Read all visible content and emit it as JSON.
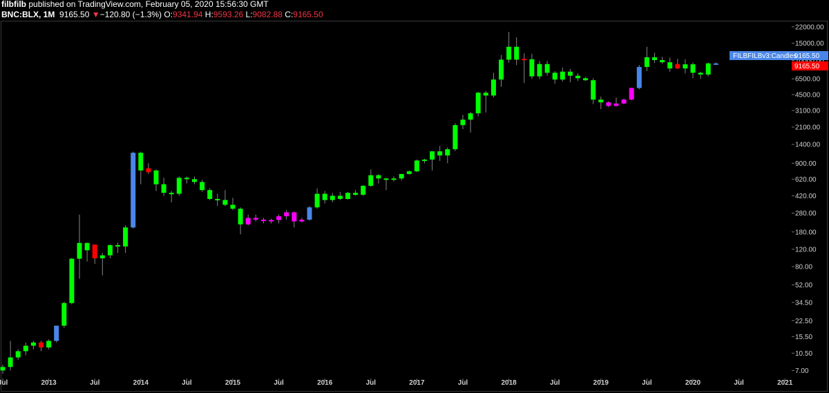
{
  "header": {
    "author": "filbfilb",
    "published_text": "published on TradingView.com, February 05, 2020 15:56:30 GMT",
    "symbol": "BNC:BLX, 1M",
    "last": "9165.50",
    "change_arrow": "▼",
    "change": "−120.80 (−1.3%)",
    "o_label": "O:",
    "o": "9341.94",
    "h_label": "H:",
    "h": "9593.26",
    "l_label": "L:",
    "l": "9082.88",
    "c_label": "C:",
    "c": "9165.50"
  },
  "colors": {
    "up": "#00ff00",
    "down": "#ff0000",
    "blue": "#4a86e8",
    "magenta": "#ff00ff",
    "wick": "#888888",
    "price_label_red": "#ff0000",
    "indicator_label_blue": "#4a86e8"
  },
  "chart_data": {
    "type": "candlestick",
    "scale": "log",
    "ylim": [
      5.8,
      25000
    ],
    "y_ticks": [
      "22000.00",
      "15000.00",
      "10000.00",
      "6500.00",
      "4500.00",
      "3100.00",
      "2100.00",
      "1400.00",
      "900.00",
      "620.00",
      "420.00",
      "280.00",
      "180.00",
      "120.00",
      "80.00",
      "52.00",
      "34.50",
      "22.50",
      "15.50",
      "10.50",
      "7.00"
    ],
    "x_ticks": [
      "Jul",
      "2013",
      "Jul",
      "2014",
      "Jul",
      "2015",
      "Jul",
      "2016",
      "Jul",
      "2017",
      "Jul",
      "2018",
      "Jul",
      "2019",
      "Jul",
      "2020",
      "Jul",
      "2021"
    ],
    "start_month": "2012-07",
    "price_labels": [
      {
        "text": "FILBFILBv3:Candles",
        "value": "9165.50",
        "color": "blue"
      },
      {
        "text": "",
        "value": "9165.50",
        "color": "red"
      }
    ],
    "candles": [
      {
        "o": 7.0,
        "h": 8.0,
        "l": 6.5,
        "c": 7.6,
        "k": "g"
      },
      {
        "o": 7.6,
        "h": 14.0,
        "l": 7.0,
        "c": 9.5,
        "k": "g"
      },
      {
        "o": 9.5,
        "h": 11.5,
        "l": 9.0,
        "c": 11.0,
        "k": "g"
      },
      {
        "o": 11.0,
        "h": 13.5,
        "l": 10.0,
        "c": 12.5,
        "k": "g"
      },
      {
        "o": 12.5,
        "h": 14.0,
        "l": 11.5,
        "c": 13.5,
        "k": "g"
      },
      {
        "o": 13.5,
        "h": 14.0,
        "l": 11.0,
        "c": 12.0,
        "k": "r"
      },
      {
        "o": 12.0,
        "h": 14.5,
        "l": 11.5,
        "c": 14.0,
        "k": "g"
      },
      {
        "o": 14.0,
        "h": 20.0,
        "l": 13.5,
        "c": 20.0,
        "k": "b"
      },
      {
        "o": 20.0,
        "h": 35.0,
        "l": 19.0,
        "c": 34.0,
        "k": "g"
      },
      {
        "o": 34.0,
        "h": 98.0,
        "l": 33.0,
        "c": 96.0,
        "k": "g"
      },
      {
        "o": 96.0,
        "h": 270.0,
        "l": 60.0,
        "c": 139.0,
        "k": "g"
      },
      {
        "o": 139.0,
        "h": 140.0,
        "l": 90.0,
        "c": 117.0,
        "k": "g"
      },
      {
        "o": 134.0,
        "h": 134.0,
        "l": 85.0,
        "c": 97.0,
        "k": "r"
      },
      {
        "o": 97.0,
        "h": 110.0,
        "l": 65.0,
        "c": 104.0,
        "k": "g"
      },
      {
        "o": 104.0,
        "h": 135.0,
        "l": 97.0,
        "c": 132.0,
        "k": "g"
      },
      {
        "o": 132.0,
        "h": 140.0,
        "l": 110.0,
        "c": 128.0,
        "k": "g"
      },
      {
        "o": 128.0,
        "h": 210.0,
        "l": 110.0,
        "c": 200.0,
        "k": "g"
      },
      {
        "o": 200.0,
        "h": 1180.0,
        "l": 195.0,
        "c": 1150.0,
        "k": "b"
      },
      {
        "o": 1150.0,
        "h": 1180.0,
        "l": 550.0,
        "c": 760.0,
        "k": "g"
      },
      {
        "o": 800.0,
        "h": 900.0,
        "l": 700.0,
        "c": 730.0,
        "k": "r"
      },
      {
        "o": 760.0,
        "h": 780.0,
        "l": 470.0,
        "c": 550.0,
        "k": "g"
      },
      {
        "o": 550.0,
        "h": 640.0,
        "l": 420.0,
        "c": 450.0,
        "k": "g"
      },
      {
        "o": 450.0,
        "h": 470.0,
        "l": 360.0,
        "c": 440.0,
        "k": "g"
      },
      {
        "o": 440.0,
        "h": 660.0,
        "l": 420.0,
        "c": 640.0,
        "k": "g"
      },
      {
        "o": 640.0,
        "h": 660.0,
        "l": 560.0,
        "c": 620.0,
        "k": "g"
      },
      {
        "o": 620.0,
        "h": 660.0,
        "l": 550.0,
        "c": 580.0,
        "k": "g"
      },
      {
        "o": 580.0,
        "h": 610.0,
        "l": 460.0,
        "c": 480.0,
        "k": "g"
      },
      {
        "o": 480.0,
        "h": 500.0,
        "l": 380.0,
        "c": 390.0,
        "k": "g"
      },
      {
        "o": 390.0,
        "h": 440.0,
        "l": 330.0,
        "c": 380.0,
        "k": "g"
      },
      {
        "o": 380.0,
        "h": 480.0,
        "l": 330.0,
        "c": 340.0,
        "k": "g"
      },
      {
        "o": 340.0,
        "h": 400.0,
        "l": 300.0,
        "c": 310.0,
        "k": "g"
      },
      {
        "o": 310.0,
        "h": 320.0,
        "l": 170.0,
        "c": 215.0,
        "k": "g"
      },
      {
        "o": 215.0,
        "h": 270.0,
        "l": 210.0,
        "c": 250.0,
        "k": "m"
      },
      {
        "o": 250.0,
        "h": 270.0,
        "l": 230.0,
        "c": 240.0,
        "k": "m"
      },
      {
        "o": 240.0,
        "h": 250.0,
        "l": 220.0,
        "c": 232.0,
        "k": "m"
      },
      {
        "o": 232.0,
        "h": 245.0,
        "l": 220.0,
        "c": 238.0,
        "k": "m"
      },
      {
        "o": 238.0,
        "h": 270.0,
        "l": 220.0,
        "c": 260.0,
        "k": "m"
      },
      {
        "o": 260.0,
        "h": 300.0,
        "l": 240.0,
        "c": 285.0,
        "k": "m"
      },
      {
        "o": 285.0,
        "h": 290.0,
        "l": 200.0,
        "c": 230.0,
        "k": "m"
      },
      {
        "o": 230.0,
        "h": 250.0,
        "l": 225.0,
        "c": 240.0,
        "k": "m"
      },
      {
        "o": 240.0,
        "h": 330.0,
        "l": 235.0,
        "c": 320.0,
        "k": "b"
      },
      {
        "o": 320.0,
        "h": 500.0,
        "l": 310.0,
        "c": 440.0,
        "k": "g"
      },
      {
        "o": 440.0,
        "h": 470.0,
        "l": 350.0,
        "c": 380.0,
        "k": "g"
      },
      {
        "o": 380.0,
        "h": 450.0,
        "l": 360.0,
        "c": 420.0,
        "k": "g"
      },
      {
        "o": 420.0,
        "h": 460.0,
        "l": 380.0,
        "c": 390.0,
        "k": "g"
      },
      {
        "o": 390.0,
        "h": 460.0,
        "l": 385.0,
        "c": 450.0,
        "k": "g"
      },
      {
        "o": 450.0,
        "h": 480.0,
        "l": 420.0,
        "c": 430.0,
        "k": "g"
      },
      {
        "o": 430.0,
        "h": 540.0,
        "l": 420.0,
        "c": 530.0,
        "k": "g"
      },
      {
        "o": 530.0,
        "h": 780.0,
        "l": 520.0,
        "c": 680.0,
        "k": "g"
      },
      {
        "o": 680.0,
        "h": 700.0,
        "l": 560.0,
        "c": 630.0,
        "k": "g"
      },
      {
        "o": 630.0,
        "h": 640.0,
        "l": 480.0,
        "c": 610.0,
        "k": "g"
      },
      {
        "o": 610.0,
        "h": 660.0,
        "l": 590.0,
        "c": 630.0,
        "k": "g"
      },
      {
        "o": 630.0,
        "h": 700.0,
        "l": 600.0,
        "c": 700.0,
        "k": "g"
      },
      {
        "o": 700.0,
        "h": 760.0,
        "l": 690.0,
        "c": 745.0,
        "k": "g"
      },
      {
        "o": 745.0,
        "h": 980.0,
        "l": 730.0,
        "c": 960.0,
        "k": "g"
      },
      {
        "o": 960.0,
        "h": 1000.0,
        "l": 900.0,
        "c": 980.0,
        "k": "g"
      },
      {
        "o": 980.0,
        "h": 1200.0,
        "l": 760.0,
        "c": 1190.0,
        "k": "g"
      },
      {
        "o": 1190.0,
        "h": 1350.0,
        "l": 950.0,
        "c": 1080.0,
        "k": "g"
      },
      {
        "o": 1080.0,
        "h": 1300.0,
        "l": 900.0,
        "c": 1250.0,
        "k": "g"
      },
      {
        "o": 1250.0,
        "h": 2300.0,
        "l": 1200.0,
        "c": 2200.0,
        "k": "g"
      },
      {
        "o": 2200.0,
        "h": 2800.0,
        "l": 2000.0,
        "c": 2500.0,
        "k": "g"
      },
      {
        "o": 2500.0,
        "h": 3000.0,
        "l": 1850.0,
        "c": 2900.0,
        "k": "g"
      },
      {
        "o": 2900.0,
        "h": 4800.0,
        "l": 2700.0,
        "c": 4700.0,
        "k": "g"
      },
      {
        "o": 4700.0,
        "h": 4900.0,
        "l": 2950.0,
        "c": 4400.0,
        "k": "g"
      },
      {
        "o": 4400.0,
        "h": 7500.0,
        "l": 4200.0,
        "c": 6400.0,
        "k": "g"
      },
      {
        "o": 6400.0,
        "h": 11400.0,
        "l": 5400.0,
        "c": 10200.0,
        "k": "g"
      },
      {
        "o": 10200.0,
        "h": 19500.0,
        "l": 9500.0,
        "c": 13800.0,
        "k": "g"
      },
      {
        "o": 13800.0,
        "h": 17200.0,
        "l": 9000.0,
        "c": 10200.0,
        "k": "g"
      },
      {
        "o": 10400.0,
        "h": 11800.0,
        "l": 5900.0,
        "c": 10300.0,
        "k": "r"
      },
      {
        "o": 10300.0,
        "h": 11700.0,
        "l": 6500.0,
        "c": 6900.0,
        "k": "g"
      },
      {
        "o": 6900.0,
        "h": 9900.0,
        "l": 6450.0,
        "c": 9200.0,
        "k": "g"
      },
      {
        "o": 9200.0,
        "h": 9900.0,
        "l": 7000.0,
        "c": 7500.0,
        "k": "g"
      },
      {
        "o": 7500.0,
        "h": 7800.0,
        "l": 5800.0,
        "c": 6400.0,
        "k": "g"
      },
      {
        "o": 6400.0,
        "h": 8500.0,
        "l": 6100.0,
        "c": 7700.0,
        "k": "g"
      },
      {
        "o": 7700.0,
        "h": 8200.0,
        "l": 6000.0,
        "c": 7000.0,
        "k": "g"
      },
      {
        "o": 7000.0,
        "h": 7400.0,
        "l": 6200.0,
        "c": 6600.0,
        "k": "g"
      },
      {
        "o": 6600.0,
        "h": 6800.0,
        "l": 6200.0,
        "c": 6300.0,
        "k": "g"
      },
      {
        "o": 6300.0,
        "h": 6600.0,
        "l": 3600.0,
        "c": 4000.0,
        "k": "g"
      },
      {
        "o": 4000.0,
        "h": 4300.0,
        "l": 3200.0,
        "c": 3750.0,
        "k": "g"
      },
      {
        "o": 3750.0,
        "h": 3850.0,
        "l": 3350.0,
        "c": 3450.0,
        "k": "m"
      },
      {
        "o": 3450.0,
        "h": 4200.0,
        "l": 3400.0,
        "c": 3650.0,
        "k": "m"
      },
      {
        "o": 3650.0,
        "h": 4100.0,
        "l": 3600.0,
        "c": 4000.0,
        "k": "m"
      },
      {
        "o": 4000.0,
        "h": 5300.0,
        "l": 3950.0,
        "c": 5250.0,
        "k": "m"
      },
      {
        "o": 5250.0,
        "h": 9000.0,
        "l": 5100.0,
        "c": 8600.0,
        "k": "b"
      },
      {
        "o": 8600.0,
        "h": 13800.0,
        "l": 7800.0,
        "c": 10800.0,
        "k": "g"
      },
      {
        "o": 10800.0,
        "h": 12000.0,
        "l": 9400.0,
        "c": 10100.0,
        "k": "g"
      },
      {
        "o": 10100.0,
        "h": 10900.0,
        "l": 9300.0,
        "c": 9600.0,
        "k": "g"
      },
      {
        "o": 9600.0,
        "h": 10700.0,
        "l": 7700.0,
        "c": 8300.0,
        "k": "g"
      },
      {
        "o": 9200.0,
        "h": 10400.0,
        "l": 8200.0,
        "c": 8300.0,
        "k": "r"
      },
      {
        "o": 8300.0,
        "h": 10300.0,
        "l": 7400.0,
        "c": 9150.0,
        "k": "g"
      },
      {
        "o": 9150.0,
        "h": 9550.0,
        "l": 6600.0,
        "c": 7500.0,
        "k": "g"
      },
      {
        "o": 7500.0,
        "h": 7700.0,
        "l": 6500.0,
        "c": 7200.0,
        "k": "g"
      },
      {
        "o": 7200.0,
        "h": 9550.0,
        "l": 6900.0,
        "c": 9350.0,
        "k": "g"
      },
      {
        "o": 9341.94,
        "h": 9593.26,
        "l": 9082.88,
        "c": 9165.5,
        "k": "b"
      }
    ]
  }
}
